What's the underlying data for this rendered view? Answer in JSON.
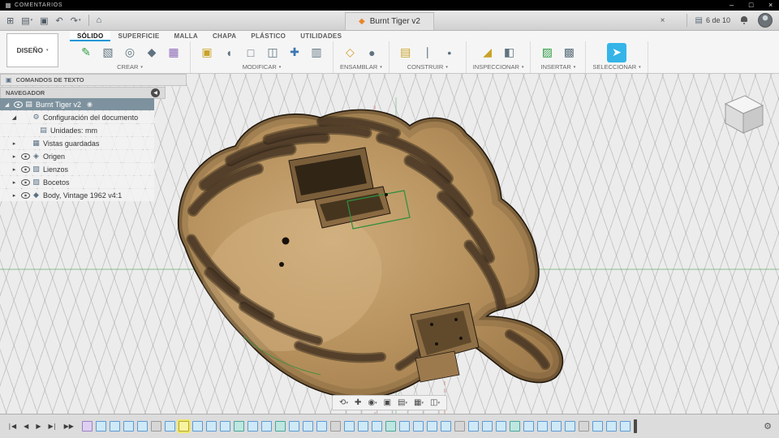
{
  "colors": {
    "accent_blue": "#0696d7",
    "viewport_bg": "#ececec",
    "wood_base": "#b28b59",
    "stripe_dark": "#4a3522",
    "selection_row": "#7d929e",
    "timeline_highlight": "#f7f3a0"
  },
  "top_bar": {
    "comments_label": "COMENTARIOS",
    "window_controls": [
      {
        "name": "minimize-button",
        "glyph": "–"
      },
      {
        "name": "maximize-button",
        "glyph": "□"
      },
      {
        "name": "close-button",
        "glyph": "×"
      }
    ]
  },
  "header": {
    "left_icons": [
      {
        "name": "app-grid-icon",
        "glyph": "⊞"
      },
      {
        "name": "file-menu-icon",
        "glyph": "▤",
        "caret": true
      },
      {
        "name": "save-icon",
        "glyph": "▣"
      },
      {
        "name": "undo-icon",
        "glyph": "↶"
      },
      {
        "name": "redo-icon",
        "glyph": "↷",
        "caret": true
      },
      {
        "name": "home-icon",
        "glyph": "⌂",
        "divider": true
      }
    ],
    "doc_tab": {
      "label": "Burnt Tiger v2"
    },
    "doc_counter": "6 de 10"
  },
  "ribbon": {
    "design_button": {
      "label": "DISEÑO"
    },
    "tabs": [
      {
        "label": "SÓLIDO",
        "active": true
      },
      {
        "label": "SUPERFICIE"
      },
      {
        "label": "MALLA"
      },
      {
        "label": "CHAPA"
      },
      {
        "label": "PLÁSTICO"
      },
      {
        "label": "UTILIDADES"
      }
    ],
    "groups": [
      {
        "label": "CREAR",
        "icons": [
          {
            "name": "create-sketch-icon",
            "glyph": "✎",
            "color": "#2f9e44"
          },
          {
            "name": "extrude-icon",
            "glyph": "▧",
            "color": "#5f7380"
          },
          {
            "name": "revolve-icon",
            "glyph": "◎",
            "color": "#5f7380"
          },
          {
            "name": "sweep-icon",
            "glyph": "◆",
            "color": "#5f7380"
          },
          {
            "name": "pattern-icon",
            "glyph": "▦",
            "color": "#8e6bb8"
          }
        ]
      },
      {
        "label": "MODIFICAR",
        "icons": [
          {
            "name": "press-pull-icon",
            "glyph": "▣",
            "color": "#c9a227"
          },
          {
            "name": "fillet-icon",
            "glyph": "◖",
            "color": "#5f7380"
          },
          {
            "name": "shell-icon",
            "glyph": "□",
            "color": "#5f7380"
          },
          {
            "name": "combine-icon",
            "glyph": "◫",
            "color": "#5f7380"
          },
          {
            "name": "move-icon",
            "glyph": "✚",
            "color": "#3b77b0"
          },
          {
            "name": "align-icon",
            "glyph": "▥",
            "color": "#5f7380"
          }
        ]
      },
      {
        "label": "ENSAMBLAR",
        "icons": [
          {
            "name": "new-component-icon",
            "glyph": "◇",
            "color": "#d49a2a"
          },
          {
            "name": "joint-icon",
            "glyph": "●",
            "color": "#5f7380"
          }
        ]
      },
      {
        "label": "CONSTRUIR",
        "icons": [
          {
            "name": "construction-plane-icon",
            "glyph": "▤",
            "color": "#c9a227"
          },
          {
            "name": "construction-axis-icon",
            "glyph": "∣",
            "color": "#5f7380"
          },
          {
            "name": "construction-point-icon",
            "glyph": "•",
            "color": "#5f7380"
          }
        ]
      },
      {
        "label": "INSPECCIONAR",
        "icons": [
          {
            "name": "measure-icon",
            "glyph": "◢",
            "color": "#c9a227"
          },
          {
            "name": "section-analysis-icon",
            "glyph": "◧",
            "color": "#5f7380"
          }
        ]
      },
      {
        "label": "INSERTAR",
        "icons": [
          {
            "name": "insert-mesh-icon",
            "glyph": "▨",
            "color": "#2f9e44"
          },
          {
            "name": "insert-svg-icon",
            "glyph": "▩",
            "color": "#5f7380"
          }
        ]
      },
      {
        "label": "SELECCIONAR",
        "icons": [
          {
            "name": "select-icon",
            "glyph": "➤",
            "color": "#ffffff",
            "bg": "#35b4e8"
          }
        ]
      }
    ]
  },
  "text_commands": {
    "label": "COMANDOS DE TEXTO"
  },
  "navigator": {
    "header": "NAVEGADOR",
    "items": [
      {
        "label": "Burnt Tiger v2",
        "depth": 0,
        "selected": true,
        "expander": "open",
        "eye": true,
        "icon": "▤",
        "badge": true
      },
      {
        "label": "Configuración del documento",
        "depth": 1,
        "expander": "open",
        "eye": false,
        "icon": "⚙"
      },
      {
        "label": "Unidades: mm",
        "depth": 2,
        "expander": "none",
        "eye": false,
        "icon": "▤"
      },
      {
        "label": "Vistas guardadas",
        "depth": 1,
        "expander": "closed",
        "eye": false,
        "icon": "▦"
      },
      {
        "label": "Origen",
        "depth": 1,
        "expander": "closed",
        "eye": true,
        "icon": "◈"
      },
      {
        "label": "Lienzos",
        "depth": 1,
        "expander": "closed",
        "eye": true,
        "icon": "▧"
      },
      {
        "label": "Bocetos",
        "depth": 1,
        "expander": "closed",
        "eye": true,
        "icon": "▨"
      },
      {
        "label": "Body, Vintage 1962 v4:1",
        "depth": 1,
        "expander": "closed",
        "eye": true,
        "icon": "◆"
      }
    ]
  },
  "nav_toolbar": [
    {
      "name": "orbit-icon",
      "glyph": "⟲",
      "caret": true
    },
    {
      "name": "pan-icon",
      "glyph": "✚",
      "caret": false
    },
    {
      "name": "zoom-icon",
      "glyph": "◉",
      "caret": true
    },
    {
      "name": "fit-icon",
      "glyph": "▣",
      "caret": false
    },
    {
      "name": "display-settings-icon",
      "glyph": "▤",
      "caret": true
    },
    {
      "name": "grid-settings-icon",
      "glyph": "▦",
      "caret": true
    },
    {
      "name": "viewports-icon",
      "glyph": "◫",
      "caret": true
    }
  ],
  "timeline": {
    "playback": [
      {
        "name": "go-to-start-button",
        "glyph": "∣◀"
      },
      {
        "name": "step-back-button",
        "glyph": "◀"
      },
      {
        "name": "play-button",
        "glyph": "▶"
      },
      {
        "name": "step-forward-button",
        "glyph": "▶∣"
      },
      {
        "name": "go-to-end-button",
        "glyph": "▶▶"
      }
    ],
    "highlight_index": 7,
    "items": [
      "purple",
      "sketch",
      "sketch",
      "sketch",
      "sketch",
      "gray",
      "sketch",
      "sketch",
      "sketch",
      "sketch",
      "sketch",
      "teal",
      "sketch",
      "sketch",
      "teal",
      "sketch",
      "sketch",
      "sketch",
      "gray",
      "sketch",
      "sketch",
      "sketch",
      "teal",
      "sketch",
      "sketch",
      "sketch",
      "sketch",
      "gray",
      "sketch",
      "sketch",
      "sketch",
      "teal",
      "sketch",
      "sketch",
      "sketch",
      "sketch",
      "gray",
      "sketch",
      "sketch",
      "sketch"
    ]
  }
}
